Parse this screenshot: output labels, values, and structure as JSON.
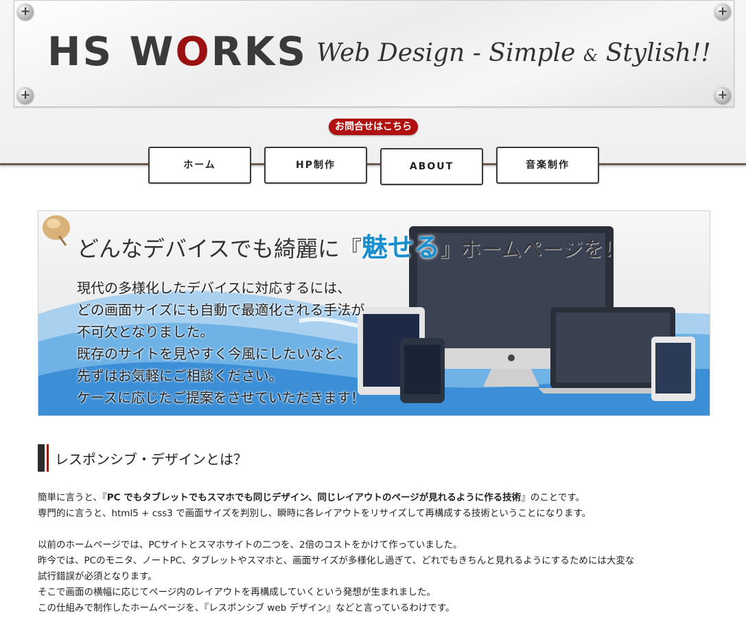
{
  "header": {
    "logo_prefix": "HS W",
    "logo_o": "O",
    "logo_suffix": "RKS",
    "tagline_main": "Web Design - Simple ",
    "tagline_amp": "&",
    "tagline_end": " Stylish!!",
    "contact_label": "お問合せはこちら"
  },
  "nav": {
    "items": [
      {
        "label": "ホーム"
      },
      {
        "label": "HP制作"
      },
      {
        "label": "ABOUT"
      },
      {
        "label": "音楽制作"
      }
    ]
  },
  "hero": {
    "headline_pre": "どんなデバイスでも綺麗に『",
    "headline_accent": "魅せる",
    "headline_post": "』ホームページを！",
    "lines": [
      "現代の多様化したデバイスに対応するには、",
      "どの画面サイズにも自動で最適化される手法が",
      "不可欠となりました。",
      "既存のサイトを見やすく今風にしたいなど、",
      "先ずはお気軽にご相談ください。",
      "ケースに応じたご提案をさせていただきます！"
    ]
  },
  "section": {
    "title": "レスポンシブ・デザインとは？",
    "p1_pre": "簡単に言うと、『",
    "p1_bold": "PC でもタブレットでもスマホでも同じデザイン、同じレイアウトのページが見れるように作る技術",
    "p1_post": "』のことです。",
    "p2": "専門的に言うと、html5 + css3 で画面サイズを判別し、瞬時に各レイアウトをリサイズして再構成する技術ということになります。",
    "p3": "以前のホームページでは、PCサイトとスマホサイトの二つを、2倍のコストをかけて作っていました。",
    "p4a": "昨今では、PCのモニタ、ノートPC、タブレットやスマホと、画面サイズが多様化し過ぎて、どれでもきちんと見れるようにするためには大変な",
    "p4b": "試行錯誤が必須となります。",
    "p5": "そこで画面の横幅に応じてページ内のレイアウトを再構成していくという発想が生まれました。",
    "p6": "この仕組みで制作したホームページを、『レスポンシブ web デザイン』などと言っているわけです。"
  },
  "colors": {
    "accent_red": "#9b1010",
    "contact_red": "#b01010",
    "hero_blue": "#1a8fd0"
  }
}
